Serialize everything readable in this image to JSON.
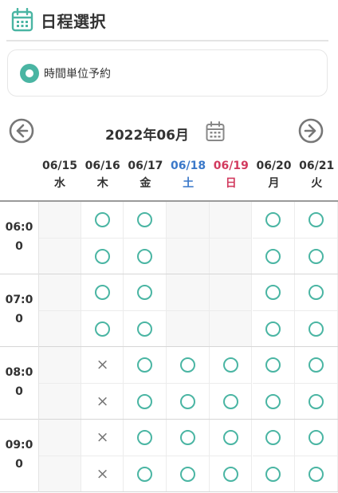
{
  "header": {
    "title": "日程選択",
    "icon": "calendar-icon",
    "accent": "#4ab5a3"
  },
  "reservation_type": {
    "label": "時間単位予約",
    "selected": true
  },
  "calendar": {
    "month_title": "2022年06月",
    "prev_icon": "arrow-left-circle-icon",
    "next_icon": "arrow-right-circle-icon",
    "picker_icon": "calendar-icon",
    "days": [
      {
        "date": "06/15",
        "weekday": "水",
        "kind": "weekday"
      },
      {
        "date": "06/16",
        "weekday": "木",
        "kind": "weekday"
      },
      {
        "date": "06/17",
        "weekday": "金",
        "kind": "weekday"
      },
      {
        "date": "06/18",
        "weekday": "土",
        "kind": "sat"
      },
      {
        "date": "06/19",
        "weekday": "日",
        "kind": "sun"
      },
      {
        "date": "06/20",
        "weekday": "月",
        "kind": "weekday"
      },
      {
        "date": "06/21",
        "weekday": "火",
        "kind": "weekday"
      }
    ],
    "time_slots": [
      {
        "label_line1": "06:0",
        "label_line2": "0",
        "rows": [
          [
            "-",
            "o",
            "o",
            "-",
            "-",
            "o",
            "o"
          ],
          [
            "-",
            "o",
            "o",
            "-",
            "-",
            "o",
            "o"
          ]
        ]
      },
      {
        "label_line1": "07:0",
        "label_line2": "0",
        "rows": [
          [
            "-",
            "o",
            "o",
            "-",
            "-",
            "o",
            "o"
          ],
          [
            "-",
            "o",
            "o",
            "-",
            "-",
            "o",
            "o"
          ]
        ]
      },
      {
        "label_line1": "08:0",
        "label_line2": "0",
        "rows": [
          [
            "-",
            "x",
            "o",
            "o",
            "o",
            "o",
            "o"
          ],
          [
            "-",
            "x",
            "o",
            "o",
            "o",
            "o",
            "o"
          ]
        ]
      },
      {
        "label_line1": "09:0",
        "label_line2": "0",
        "rows": [
          [
            "-",
            "x",
            "o",
            "o",
            "o",
            "o",
            "o"
          ],
          [
            "-",
            "x",
            "o",
            "o",
            "o",
            "o",
            "o"
          ]
        ]
      }
    ],
    "symbols": {
      "available": "○",
      "unavailable": "×",
      "closed": ""
    },
    "colors": {
      "available": "#4ab5a3",
      "saturday": "#3a78c9",
      "sunday": "#d23a5e",
      "closed_bg": "#f7f7f7"
    }
  }
}
